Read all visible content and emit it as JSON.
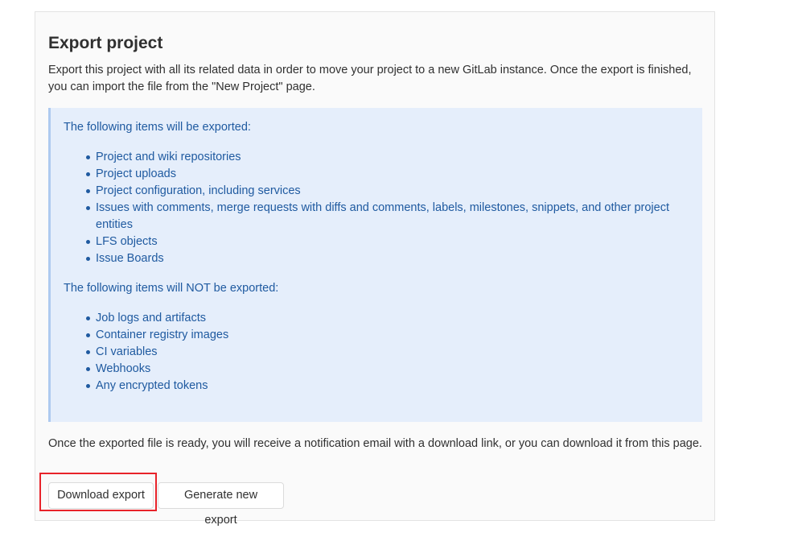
{
  "title": "Export project",
  "intro": "Export this project with all its related data in order to move your project to a new GitLab instance. Once the export is finished, you can import the file from the \"New Project\" page.",
  "exported": {
    "heading": "The following items will be exported:",
    "items": [
      "Project and wiki repositories",
      "Project uploads",
      "Project configuration, including services",
      "Issues with comments, merge requests with diffs and comments, labels, milestones, snippets, and other project entities",
      "LFS objects",
      "Issue Boards"
    ]
  },
  "not_exported": {
    "heading": "The following items will NOT be exported:",
    "items": [
      "Job logs and artifacts",
      "Container registry images",
      "CI variables",
      "Webhooks",
      "Any encrypted tokens"
    ]
  },
  "notification": "Once the exported file is ready, you will receive a notification email with a download link, or you can download it from this page.",
  "buttons": {
    "download": "Download export",
    "generate": "Generate new export"
  },
  "colors": {
    "callout_bg": "#e5eefb",
    "callout_text": "#1f5aa0",
    "highlight": "#e8232a"
  }
}
